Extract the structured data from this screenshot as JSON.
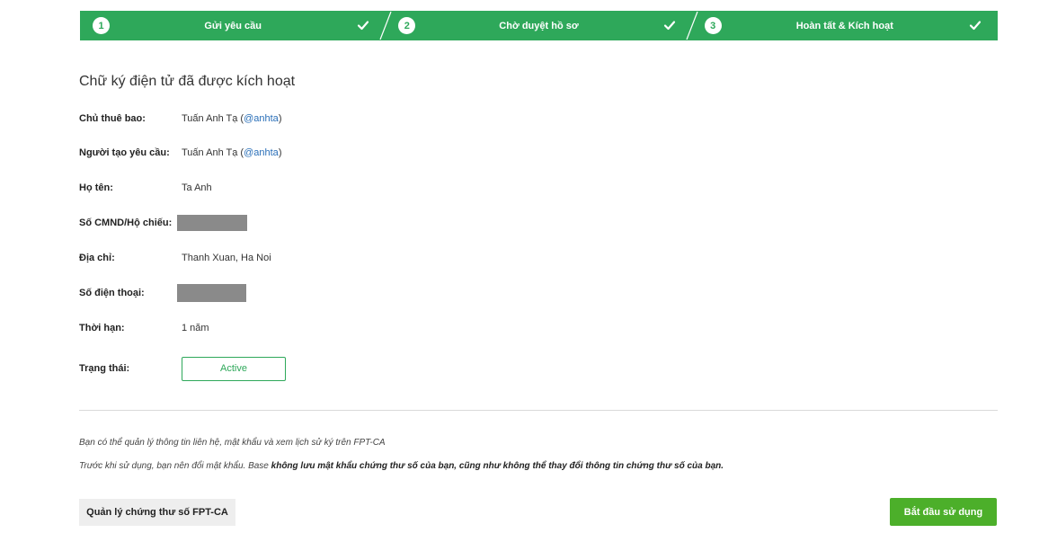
{
  "steps": [
    {
      "number": "1",
      "label": "Gửi yêu cầu",
      "status": "done"
    },
    {
      "number": "2",
      "label": "Chờ duyệt hồ sơ",
      "status": "done"
    },
    {
      "number": "3",
      "label": "Hoàn tất & Kích hoạt",
      "status": "done"
    }
  ],
  "title": "Chữ ký điện tử đã được kích hoạt",
  "fields": {
    "subscriber": {
      "label": "Chủ thuê bao:",
      "name": "Tuấn Anh Tạ (",
      "handle": "@anhta",
      "close": ")"
    },
    "requester": {
      "label": "Người tạo yêu cầu:",
      "name": "Tuấn Anh Tạ (",
      "handle": "@anhta",
      "close": ")"
    },
    "full_name": {
      "label": "Họ tên:",
      "value": "Ta Anh"
    },
    "id_number": {
      "label": "Số CMND/Hộ chiếu:"
    },
    "address": {
      "label": "Địa chỉ:",
      "value": "Thanh Xuan, Ha Noi"
    },
    "phone": {
      "label": "Số điện thoại:"
    },
    "duration": {
      "label": "Thời hạn:",
      "value": "1 năm"
    },
    "status": {
      "label": "Trạng thái:",
      "value": "Active"
    }
  },
  "notes": {
    "line1": "Bạn có thể quản lý thông tin liên hệ, mật khẩu và xem lịch sử ký trên FPT-CA",
    "line2_prefix": "Trước khi sử dụng, bạn nên đổi mật khẩu. Base ",
    "line2_bold": "không lưu mật khẩu chứng thư số của bạn, cũng như không thể thay đổi thông tin chứng thư số của bạn."
  },
  "buttons": {
    "manage": "Quản lý chứng thư số FPT-CA",
    "start": "Bắt đầu sử dụng"
  },
  "colors": {
    "step_bar": "#2ea85a",
    "primary_button": "#4caf2a",
    "link": "#2a6fb8"
  }
}
